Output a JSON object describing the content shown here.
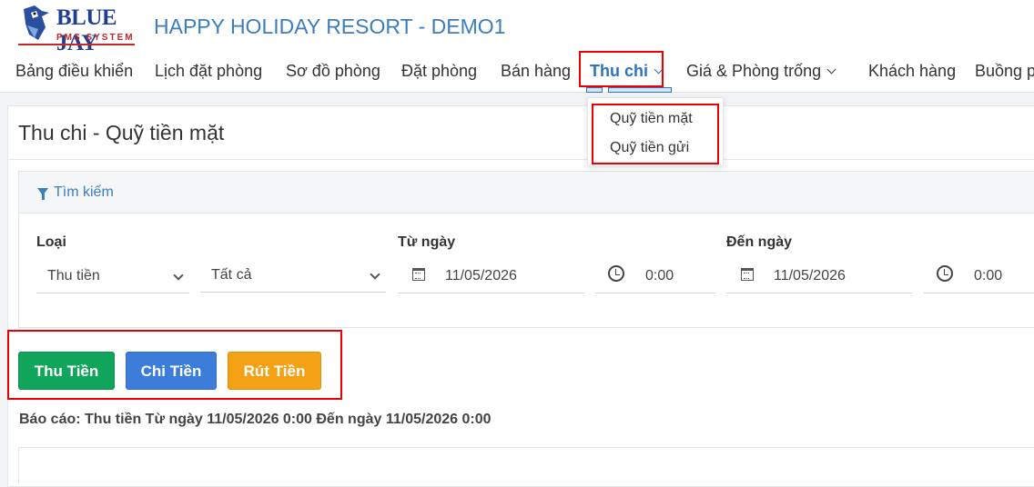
{
  "brand": {
    "name": "BLUE JAY",
    "tagline": "PMS SYSTEM"
  },
  "header": {
    "hotel_name": "HAPPY HOLIDAY RESORT - DEMO1"
  },
  "nav": {
    "items": [
      {
        "label": "Bảng điều khiển"
      },
      {
        "label": "Lịch đặt phòng"
      },
      {
        "label": "Sơ đồ phòng"
      },
      {
        "label": "Đặt phòng"
      },
      {
        "label": "Bán hàng"
      },
      {
        "label": "Thu chi"
      },
      {
        "label": "Giá & Phòng trống"
      },
      {
        "label": "Khách hàng"
      },
      {
        "label": "Buồng phòng"
      }
    ]
  },
  "dropdown": {
    "items": [
      "Quỹ tiền mặt",
      "Quỹ tiền gửi"
    ]
  },
  "page": {
    "title": "Thu chi - Quỹ tiền mặt"
  },
  "search": {
    "title": "Tìm kiếm",
    "type_label": "Loại",
    "type_value": "Thu tiền",
    "category_value": "Tất cả",
    "from_label": "Từ ngày",
    "from_date": "11/05/2026",
    "from_time": "0:00",
    "to_label": "Đến ngày",
    "to_date": "11/05/2026",
    "to_time": "0:00"
  },
  "actions": {
    "collect": "Thu Tiền",
    "spend": "Chi Tiền",
    "withdraw": "Rút Tiền"
  },
  "report": {
    "text": "Báo cáo: Thu tiền Từ ngày 11/05/2026 0:00 Đến ngày 11/05/2026 0:00"
  },
  "colors": {
    "accent": "#2a74c0",
    "green": "#11a55b",
    "blue": "#3b7dd8",
    "orange": "#f4a215",
    "highlight": "#e00000"
  }
}
